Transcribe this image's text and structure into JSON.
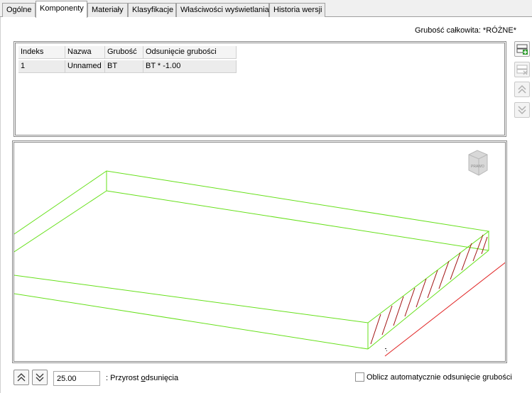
{
  "tabs": [
    {
      "label": "Ogólne"
    },
    {
      "label": "Komponenty",
      "active": true
    },
    {
      "label": "Materiały"
    },
    {
      "label": "Klasyfikacje"
    },
    {
      "label": "Właściwości wyświetlania"
    },
    {
      "label": "Historia wersji"
    }
  ],
  "total_thickness": "Grubość całkowita: *RÓŻNE*",
  "table": {
    "headers": [
      "Indeks",
      "Nazwa",
      "Grubość",
      "Odsunięcie grubości"
    ],
    "rows": [
      [
        "1",
        "Unnamed",
        "BT",
        "BT * -1.00"
      ]
    ]
  },
  "side_buttons": {
    "add": "add-row-icon",
    "delete": "delete-row-icon",
    "up": "move-up-icon",
    "down": "move-down-icon"
  },
  "preview": {
    "viewcube_label": "PRAWO",
    "outline_color": "#66e01a",
    "hatch_color": "#a01010",
    "reference_line_color": "#e02020"
  },
  "offset_increment": {
    "value": "25.00",
    "label_prefix": ": Przyrost ",
    "label_underlined": "o",
    "label_rest": "dsunięcia"
  },
  "auto_offset": {
    "label": "Oblicz automatycznie odsunięcie grubości",
    "checked": false
  }
}
